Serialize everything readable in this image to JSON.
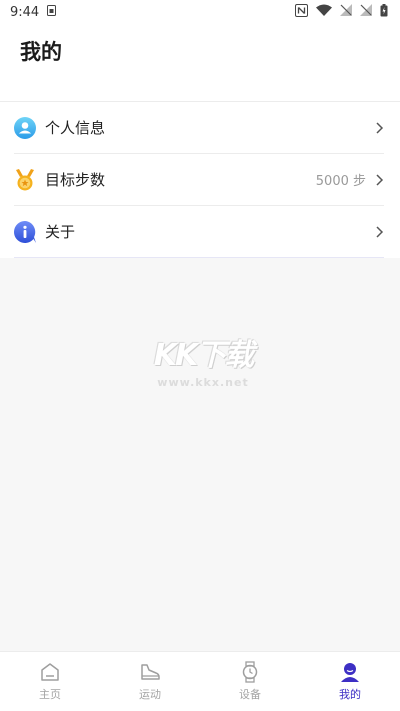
{
  "status_bar": {
    "time": "9:44",
    "icons": [
      "sim-card-icon",
      "nfc-icon",
      "wifi-icon",
      "no-signal-icon",
      "no-signal-icon",
      "battery-charging-icon"
    ]
  },
  "header": {
    "title": "我的"
  },
  "menu": {
    "items": [
      {
        "label": "个人信息",
        "value": "",
        "icon": "user-profile-icon"
      },
      {
        "label": "目标步数",
        "value": "5000 步",
        "icon": "medal-icon"
      },
      {
        "label": "关于",
        "value": "",
        "icon": "info-icon"
      }
    ]
  },
  "watermark": {
    "logo": "KK下载",
    "url": "www.kkx.net"
  },
  "tabbar": {
    "active": 3,
    "tabs": [
      {
        "label": "主页",
        "icon": "home-icon"
      },
      {
        "label": "运动",
        "icon": "shoe-icon"
      },
      {
        "label": "设备",
        "icon": "watch-icon"
      },
      {
        "label": "我的",
        "icon": "person-icon"
      }
    ]
  },
  "colors": {
    "accent": "#3d2fc4",
    "inactive": "#a4a4a4",
    "background": "#f7f7f7"
  }
}
